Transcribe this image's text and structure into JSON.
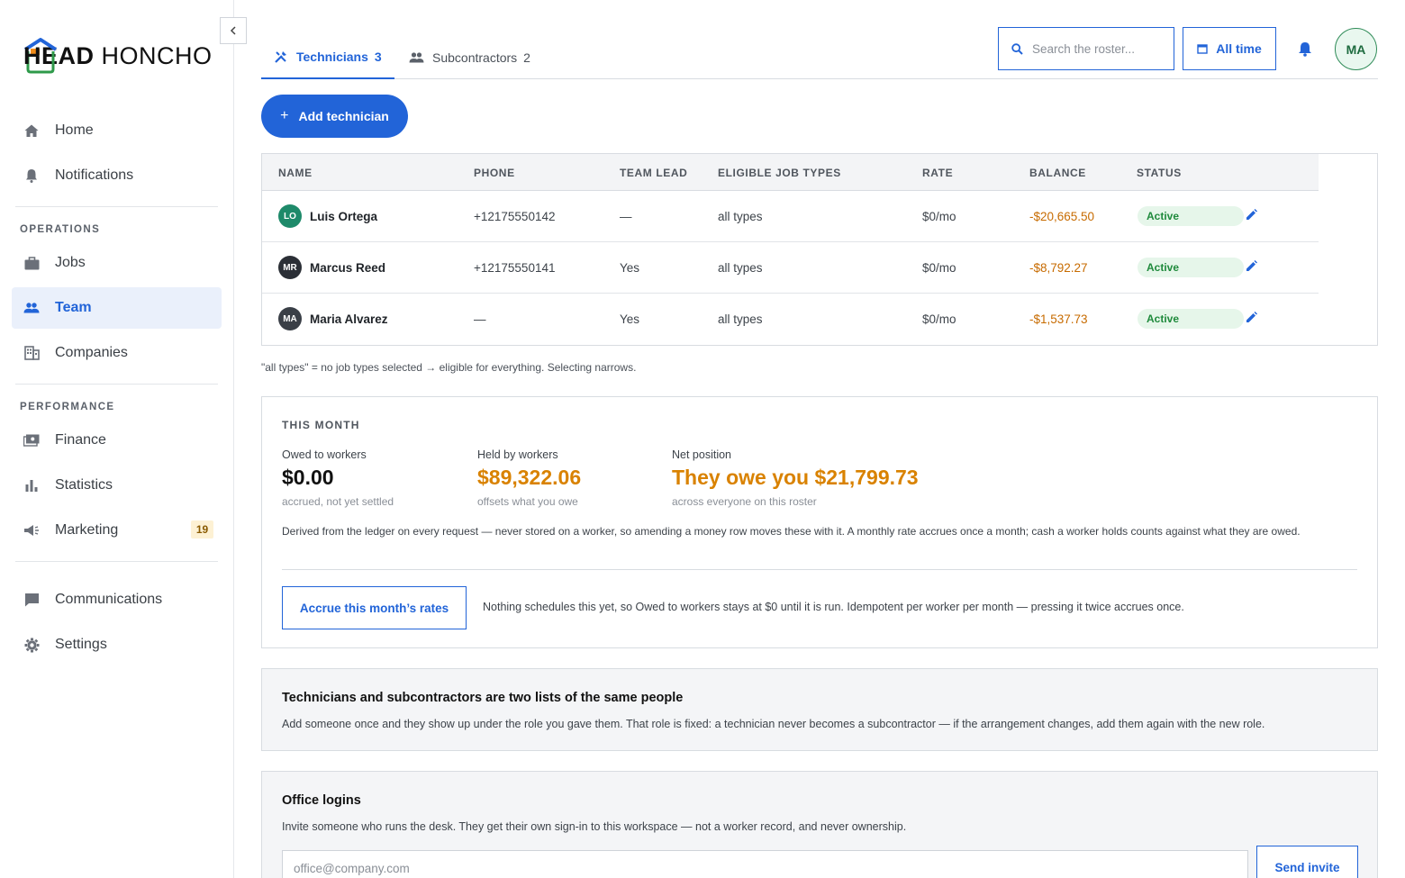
{
  "app": {
    "logo_letter": "H",
    "logo_bold": "EAD",
    "logo_rest": " HONCHO"
  },
  "sidebar": {
    "collapse_icon": "chevron-left-icon",
    "items": [
      {
        "label": "Home",
        "icon": "home-icon"
      },
      {
        "label": "Notifications",
        "icon": "bell-icon"
      },
      {
        "label": "Jobs",
        "icon": "briefcase-icon"
      },
      {
        "label": "Team",
        "icon": "team-icon",
        "active": true
      },
      {
        "label": "Companies",
        "icon": "building-icon"
      },
      {
        "label": "Finance",
        "icon": "money-icon"
      },
      {
        "label": "Statistics",
        "icon": "bar-chart-icon"
      },
      {
        "label": "Marketing",
        "icon": "megaphone-icon",
        "badge": "19"
      },
      {
        "label": "Communications",
        "icon": "chat-icon"
      },
      {
        "label": "Settings",
        "icon": "gear-icon"
      }
    ],
    "sections": {
      "operations": "OPERATIONS",
      "performance": "PERFORMANCE"
    }
  },
  "tabs": [
    {
      "label": "Technicians",
      "count": "3",
      "icon": "tools-icon",
      "active": true
    },
    {
      "label": "Subcontractors",
      "count": "2",
      "icon": "people-icon"
    }
  ],
  "header": {
    "search_placeholder": "Search the roster...",
    "date_filter": "All time",
    "avatar_initials": "MA"
  },
  "add_button": "Add technician",
  "table": {
    "columns": [
      "NAME",
      "PHONE",
      "TEAM LEAD",
      "ELIGIBLE JOB TYPES",
      "RATE",
      "BALANCE",
      "STATUS"
    ],
    "rows": [
      {
        "initials": "LO",
        "name": "Luis Ortega",
        "phone": "+12175550142",
        "team_lead": "—",
        "job_types": "all types",
        "rate": "$0/mo",
        "balance": "-$20,665.50",
        "status": "Active",
        "avatar_color": "#1e8a6a"
      },
      {
        "initials": "MR",
        "name": "Marcus Reed",
        "phone": "+12175550141",
        "team_lead": "Yes",
        "job_types": "all types",
        "rate": "$0/mo",
        "balance": "-$8,792.27",
        "status": "Active",
        "avatar_color": "#2b2f36"
      },
      {
        "initials": "MA",
        "name": "Maria Alvarez",
        "phone": "—",
        "team_lead": "Yes",
        "job_types": "all types",
        "rate": "$0/mo",
        "balance": "-$1,537.73",
        "status": "Active",
        "avatar_color": "#3a3f47"
      }
    ]
  },
  "footnote": "\"all types\" = no job types selected → eligible for everything. Selecting narrows.",
  "this_month": {
    "title": "THIS MONTH",
    "stats": [
      {
        "label": "Owed to workers",
        "value": "$0.00",
        "sub": "accrued, not yet settled"
      },
      {
        "label": "Held by workers",
        "value": "$89,322.06",
        "sub": "offsets what you owe"
      },
      {
        "label": "Net position",
        "value": "They owe you $21,799.73",
        "sub": "across everyone on this roster"
      }
    ],
    "note": "Derived from the ledger on every request — never stored on a worker, so amending a money row moves these with it. A monthly rate accrues once a month; cash a worker holds counts against what they are owed.",
    "accrue_button": "Accrue this month’s rates",
    "accrue_note": "Nothing schedules this yet, so Owed to workers stays at $0 until it is run. Idempotent per worker per month — pressing it twice accrues once."
  },
  "info": {
    "title": "Technicians and subcontractors are two lists of the same people",
    "text": "Add someone once and they show up under the role you gave them. That role is fixed: a technician never becomes a subcontractor — if the arrangement changes, add them again with the new role."
  },
  "office": {
    "title": "Office logins",
    "text": "Invite someone who runs the desk. They get their own sign-in to this workspace — not a worker record, and never ownership.",
    "email_placeholder": "office@company.com",
    "send_button": "Send invite"
  },
  "colors": {
    "accent": "#2264d8",
    "balance": "#c76b00",
    "held": "#d98200",
    "active": "#1f8a3c"
  }
}
